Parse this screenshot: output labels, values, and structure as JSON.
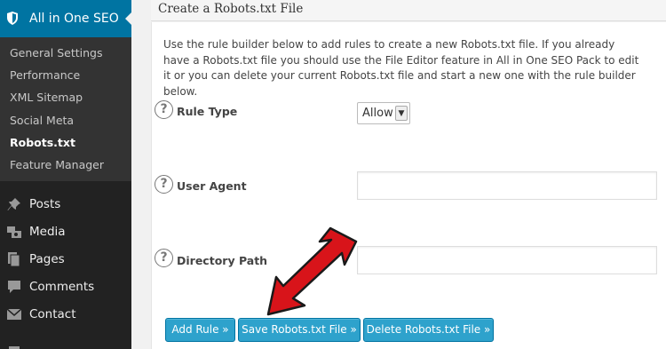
{
  "sidebar": {
    "plugin_title": "All in One SEO",
    "submenu": [
      {
        "label": "General Settings",
        "current": false
      },
      {
        "label": "Performance",
        "current": false
      },
      {
        "label": "XML Sitemap",
        "current": false
      },
      {
        "label": "Social Meta",
        "current": false
      },
      {
        "label": "Robots.txt",
        "current": true
      },
      {
        "label": "Feature Manager",
        "current": false
      }
    ],
    "menu": [
      {
        "label": "Posts",
        "icon": "pushpin-icon"
      },
      {
        "label": "Media",
        "icon": "media-icon"
      },
      {
        "label": "Pages",
        "icon": "pages-icon"
      },
      {
        "label": "Comments",
        "icon": "comment-icon"
      },
      {
        "label": "Contact",
        "icon": "envelope-icon"
      }
    ]
  },
  "panel": {
    "title": "Create a Robots.txt File",
    "intro": "Use the rule builder below to add rules to create a new Robots.txt file.  If you already have a Robots.txt file you should use the File Editor feature in All in One SEO Pack to edit it or you can delete your current Robots.txt file and start a new one with the rule builder below."
  },
  "form": {
    "help_glyph": "?",
    "rule_type": {
      "label": "Rule Type",
      "value": "Allow"
    },
    "user_agent": {
      "label": "User Agent",
      "value": ""
    },
    "directory_path": {
      "label": "Directory Path",
      "value": ""
    }
  },
  "buttons": {
    "add_rule": "Add Rule »",
    "save": "Save Robots.txt File »",
    "delete": "Delete Robots.txt File »"
  },
  "colors": {
    "sidebar_bg": "#222222",
    "submenu_bg": "#333333",
    "accent": "#0074a2",
    "button": "#2ea2cc",
    "annotation_arrow": "#d8141a"
  }
}
